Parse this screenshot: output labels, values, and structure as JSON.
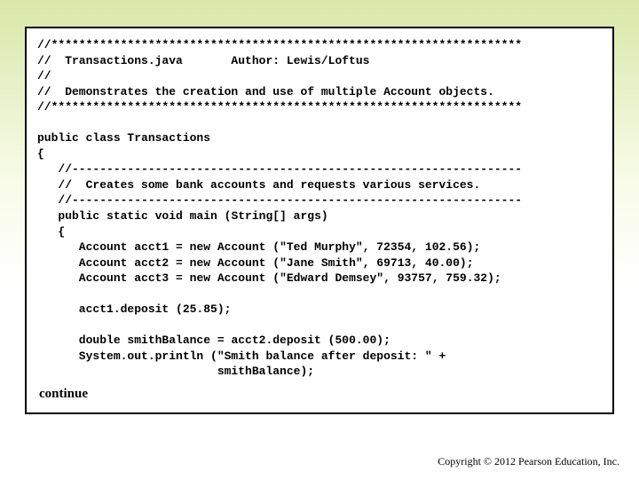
{
  "code": {
    "l1": "//********************************************************************",
    "l2": "//  Transactions.java       Author: Lewis/Loftus",
    "l3": "//",
    "l4": "//  Demonstrates the creation and use of multiple Account objects.",
    "l5": "//********************************************************************",
    "blank1": "",
    "l6a": "public class ",
    "l6b": "Transactions",
    "l7": "{",
    "l8": "   //-----------------------------------------------------------------",
    "l9": "   //  Creates some bank accounts and requests various services.",
    "l10": "   //-----------------------------------------------------------------",
    "l11a": "   public static void ",
    "l11b": "main (String[] args)",
    "l12": "   {",
    "l13a": "      Account acct1 = ",
    "l13b": "new ",
    "l13c": "Account (\"Ted Murphy\", 72354, 102.56);",
    "l14a": "      Account acct2 = ",
    "l14b": "new ",
    "l14c": "Account (\"Jane Smith\", 69713, 40.00);",
    "l15a": "      Account acct3 = ",
    "l15b": "new ",
    "l15c": "Account (\"Edward Demsey\", 93757, 759.32);",
    "blank2": "",
    "l16": "      acct1.deposit (25.85);",
    "blank3": "",
    "l17a": "      double ",
    "l17b": "smithBalance = acct2.deposit (500.00);",
    "l18": "      System.out.println (\"Smith balance after deposit: \" +",
    "l19": "                          smithBalance);"
  },
  "continue_label": "continue",
  "copyright": "Copyright © 2012 Pearson Education, Inc."
}
